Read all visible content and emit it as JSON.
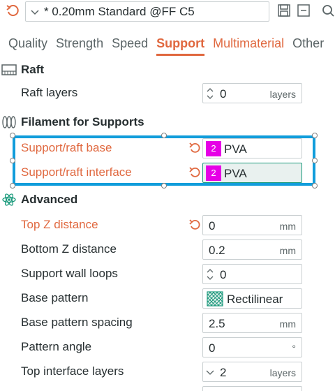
{
  "preset": {
    "name": "* 0.20mm Standard @FF C5"
  },
  "tabs": [
    {
      "label": "Quality"
    },
    {
      "label": "Strength"
    },
    {
      "label": "Speed"
    },
    {
      "label": "Support",
      "active": true
    },
    {
      "label": "Multimaterial"
    },
    {
      "label": "Other"
    }
  ],
  "sections": {
    "raft": "Raft",
    "filament": "Filament for Supports",
    "advanced": "Advanced"
  },
  "raft": {
    "raft_layers": {
      "label": "Raft layers",
      "value": "0",
      "unit": "layers"
    }
  },
  "filament": {
    "base": {
      "label": "Support/raft base",
      "badge": "2",
      "value": "PVA"
    },
    "interface": {
      "label": "Support/raft interface",
      "badge": "2",
      "value": "PVA"
    }
  },
  "advanced": {
    "top_z": {
      "label": "Top Z distance",
      "value": "0",
      "unit": "mm"
    },
    "bottom_z": {
      "label": "Bottom Z distance",
      "value": "0.2",
      "unit": "mm"
    },
    "wall_loops": {
      "label": "Support wall loops",
      "value": "0"
    },
    "base_pattern": {
      "label": "Base pattern",
      "value": "Rectilinear"
    },
    "base_spacing": {
      "label": "Base pattern spacing",
      "value": "2.5",
      "unit": "mm"
    },
    "pattern_angle": {
      "label": "Pattern angle",
      "value": "0",
      "unit": "°"
    },
    "top_interface": {
      "label": "Top interface layers",
      "value": "2",
      "unit": "layers"
    }
  },
  "colors": {
    "accent": "#e0683f",
    "selection": "#119ddb",
    "badge": "#e600e6",
    "focus": "#1a9a7c"
  },
  "icons": [
    "reset-icon",
    "chevron-down-icon",
    "save-icon",
    "minus-box-icon",
    "search-icon",
    "raft-icon",
    "filament-icon",
    "advanced-icon",
    "undo-icon",
    "spinner-icon",
    "rectilinear-pattern-icon"
  ]
}
